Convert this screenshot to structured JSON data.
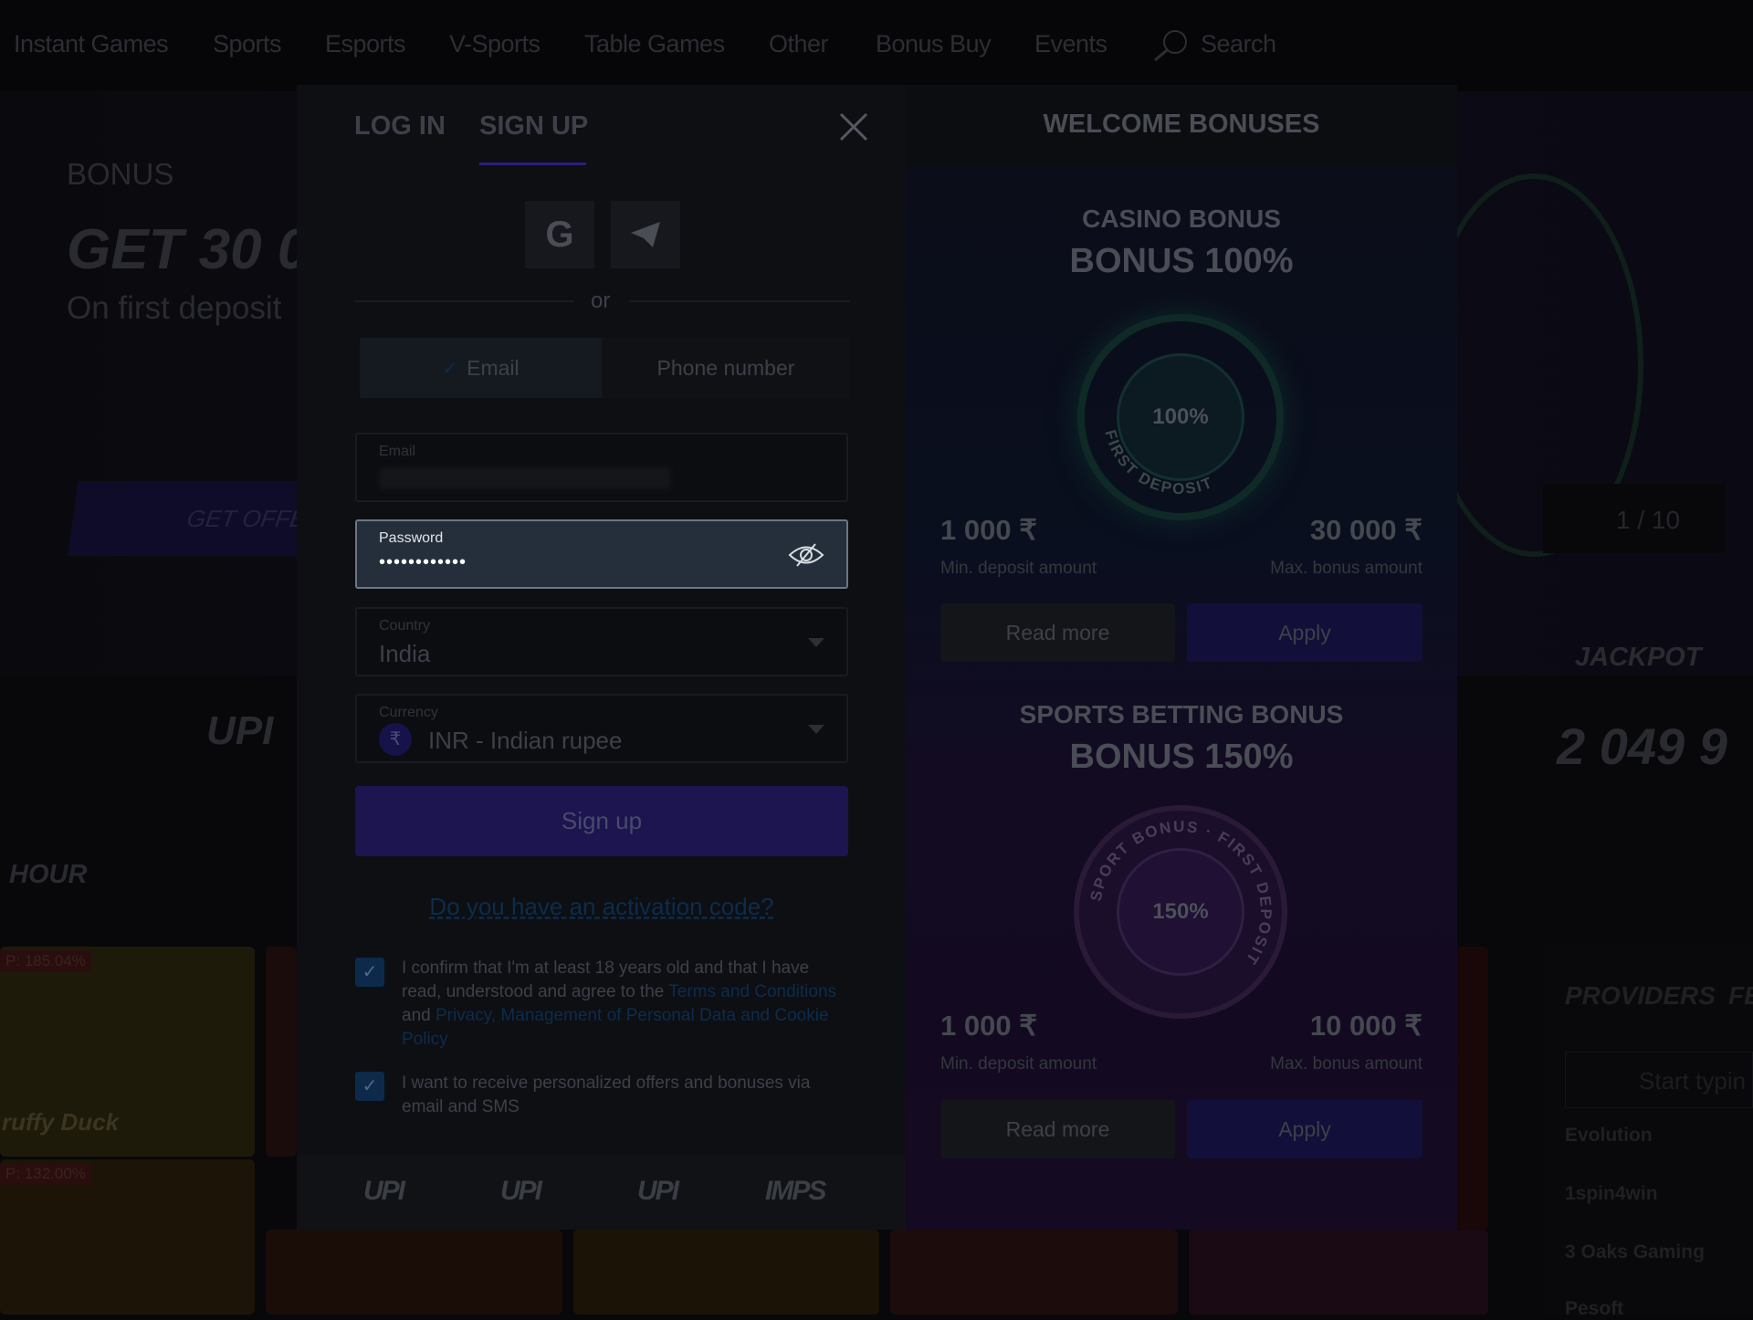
{
  "nav": {
    "items": [
      "Instant Games",
      "Sports",
      "Esports",
      "V-Sports",
      "Table Games",
      "Other",
      "Bonus Buy",
      "Events"
    ],
    "search_label": "Search"
  },
  "banner": {
    "eyebrow": "BONUS",
    "headline": "GET 30 00",
    "sub": "On first deposit",
    "cta": "GET OFFER",
    "slide_counter": "1 / 10"
  },
  "section_title": "HOUR",
  "jackpot": {
    "label": "JACKPOT",
    "value": "2 049 9"
  },
  "games": [
    {
      "rtp": "P: 185.04%",
      "title": "ruffy Duck"
    },
    {
      "rtp": "P: 132.00%",
      "title": ""
    }
  ],
  "providers": {
    "tabs": [
      "PROVIDERS",
      "FE"
    ],
    "search_placeholder": "Start typin",
    "items": [
      "Evolution",
      "1spin4win",
      "3 Oaks Gaming",
      "Pesoft"
    ]
  },
  "modal": {
    "tabs": {
      "login": "LOG IN",
      "signup": "SIGN UP",
      "active": "signup"
    },
    "or": "or",
    "method_toggle": {
      "email": "Email",
      "phone": "Phone number",
      "selected": "email"
    },
    "email": {
      "label": "Email",
      "value": ""
    },
    "password": {
      "label": "Password",
      "value": "••••••••••••"
    },
    "country": {
      "label": "Country",
      "value": "India"
    },
    "currency": {
      "label": "Currency",
      "symbol": "₹",
      "value": "INR - Indian rupee"
    },
    "signup_button": "Sign up",
    "activation_link": "Do you have an activation code?",
    "consent1": {
      "text": "I confirm that I'm at least 18 years old and that I have read, understood and agree to the ",
      "link1": "Terms and Conditions",
      "and": " and ",
      "link2": "Privacy, Management of Personal Data and Cookie Policy",
      "checked": true
    },
    "consent2": {
      "text": "I want to receive personalized offers and bonuses via email and SMS",
      "checked": true
    },
    "payment_logos": [
      "UPI",
      "UPI",
      "UPI",
      "IMPS"
    ]
  },
  "bonuses": {
    "title": "WELCOME BONUSES",
    "items": [
      {
        "name": "CASINO BONUS",
        "bonus": "BONUS 100%",
        "badge": "100%",
        "ring_text": "FIRST DEPOSIT",
        "min": "1 000 ₹",
        "min_label": "Min. deposit amount",
        "max": "30 000 ₹",
        "max_label": "Max. bonus amount",
        "read_more": "Read more",
        "apply": "Apply"
      },
      {
        "name": "SPORTS BETTING BONUS",
        "bonus": "BONUS 150%",
        "badge": "150%",
        "ring_text": "SPORT BONUS · FIRST DEPOSIT",
        "min": "1 000 ₹",
        "min_label": "Min. deposit amount",
        "max": "10 000 ₹",
        "max_label": "Max. bonus amount",
        "read_more": "Read more",
        "apply": "Apply"
      }
    ]
  },
  "colors": {
    "accent": "#2a1f7a",
    "active_field_bg": "#252f3b",
    "link": "#0d2c4d"
  }
}
